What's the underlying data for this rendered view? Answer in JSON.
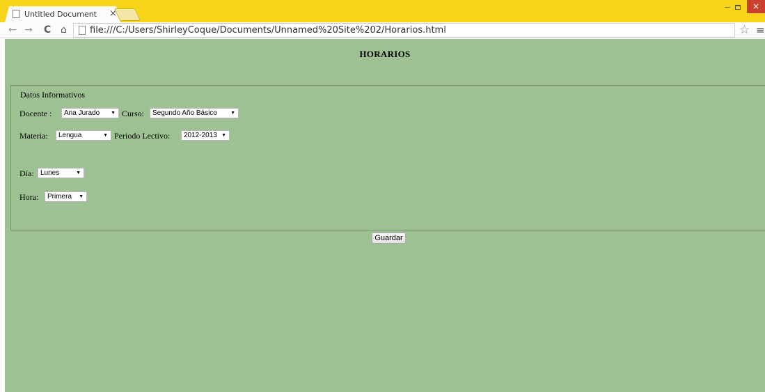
{
  "browser": {
    "tab_title": "Untitled Document",
    "tab_close": "×",
    "url": "file:///C:/Users/ShirleyCoque/Documents/Unnamed%20Site%202/Horarios.html",
    "window_min": "–",
    "window_close": "×",
    "icons": {
      "back": "back-arrow-icon",
      "forward": "forward-arrow-icon",
      "reload": "reload-icon",
      "home": "home-icon",
      "star": "star-icon",
      "menu": "menu-icon"
    }
  },
  "page": {
    "background": "#9dc192",
    "title": "HORARIOS",
    "form": {
      "legend": "Datos Informativos",
      "docente_label": "Docente :",
      "docente_value": "Ana Jurado",
      "curso_label": "Curso:",
      "curso_value": "Segundo Año Básico",
      "materia_label": "Materia:",
      "materia_value": "Lengua",
      "periodo_label": "Periodo Lectivo:",
      "periodo_value": "2012-2013",
      "dia_label": "Día:",
      "dia_value": "Lunes",
      "hora_label": "Hora:",
      "hora_value": "Primera"
    },
    "save_button": "Guardar"
  }
}
